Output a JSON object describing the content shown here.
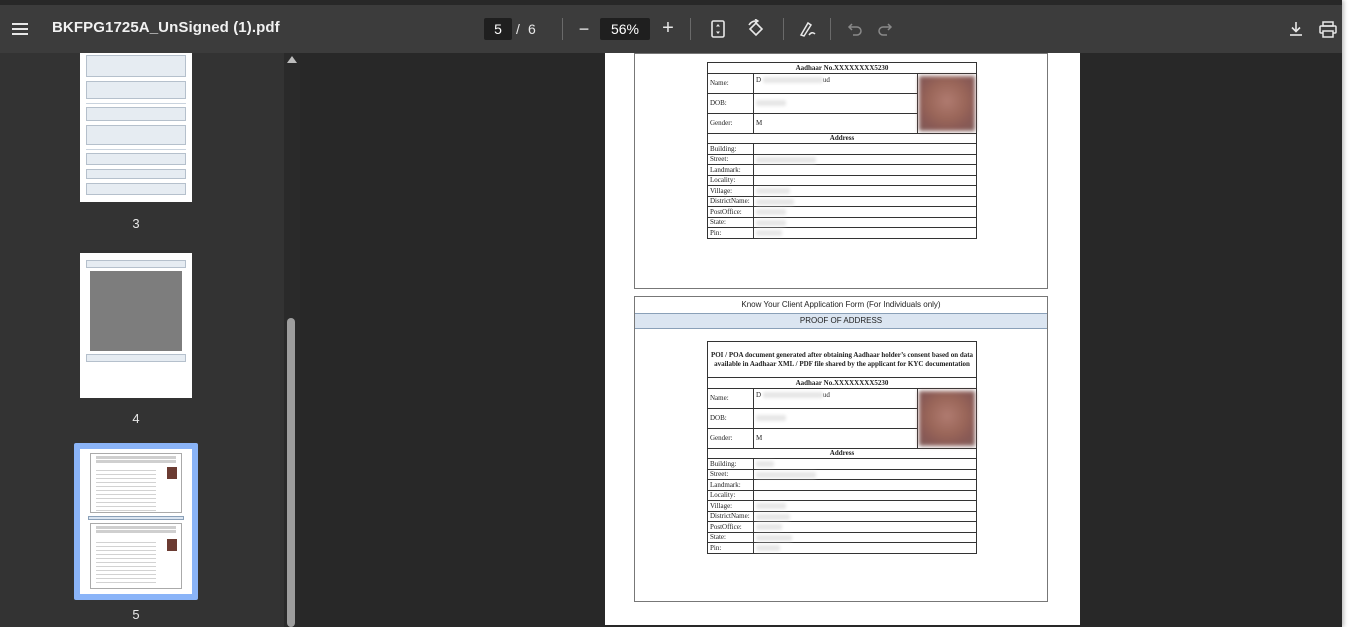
{
  "toolbar": {
    "menu_icon": "menu-icon",
    "title": "BKFPG1725A_UnSigned (1).pdf",
    "current_page": "5",
    "page_separator": "/",
    "total_pages": "6",
    "zoom_out_label": "−",
    "zoom": "56%",
    "zoom_in_label": "+",
    "fit_icon": "fit-page-icon",
    "rotate_icon": "rotate-icon",
    "draw_icon": "draw-icon",
    "undo_icon": "undo-icon",
    "redo_icon": "redo-icon",
    "download_icon": "download-icon",
    "print_icon": "print-icon"
  },
  "sidebar": {
    "thumbnails": [
      {
        "label": "3"
      },
      {
        "label": "4"
      },
      {
        "label": "5",
        "selected": true
      }
    ]
  },
  "document": {
    "top_section": {
      "aadhaar_no": "Aadhaar No.XXXXXXXX5230",
      "rows": [
        {
          "label": "Name:",
          "value_start": "D",
          "value_end": "ud"
        },
        {
          "label": "DOB:",
          "value_start": "",
          "value_end": ""
        },
        {
          "label": "Gender:",
          "value_start": "M",
          "value_end": ""
        }
      ],
      "address_header": "Address",
      "address_rows": [
        "Building:",
        "Street:",
        "Landmark:",
        "Locality:",
        "Village:",
        "DistrictName:",
        "PostOffice:",
        "State:",
        "Pin:"
      ]
    },
    "form_title": "Know Your Client Application Form (For Individuals only)",
    "section_title": "PROOF OF ADDRESS",
    "bottom_section": {
      "consent_text": "POI / POA document generated after obtaining Aadhaar holder’s consent based on data available in Aadhaar XML / PDF file shared by the applicant for KYC documentation",
      "aadhaar_no": "Aadhaar No.XXXXXXXX5230",
      "rows": [
        {
          "label": "Name:",
          "value_start": "D",
          "value_end": "ud"
        },
        {
          "label": "DOB:",
          "value_start": "",
          "value_end": ""
        },
        {
          "label": "Gender:",
          "value_start": "M",
          "value_end": ""
        }
      ],
      "address_header": "Address",
      "address_rows": [
        "Building:",
        "Street:",
        "Landmark:",
        "Locality:",
        "Village:",
        "DistrictName:",
        "PostOffice:",
        "State:",
        "Pin:"
      ]
    }
  }
}
